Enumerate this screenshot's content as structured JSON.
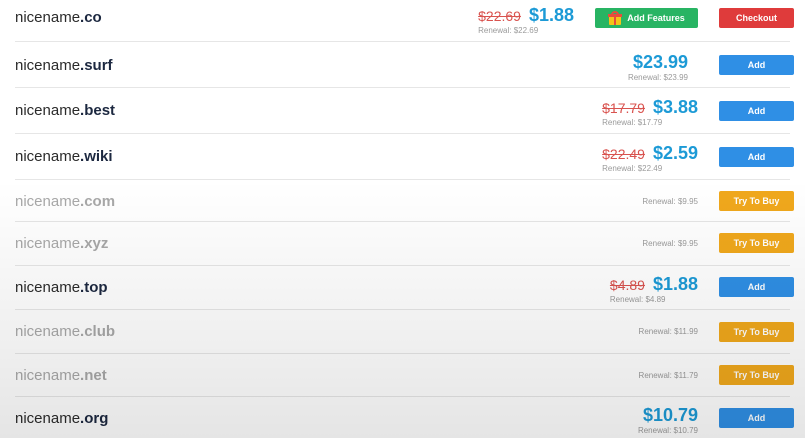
{
  "domains": [
    {
      "name": "nicename",
      "tld": ".co",
      "old_price": "$22.69",
      "price": "$1.88",
      "renewal": "Renewal: $22.69",
      "features_label": "Add Features",
      "action": "Checkout"
    },
    {
      "name": "nicename",
      "tld": ".surf",
      "price": "$23.99",
      "renewal": "Renewal: $23.99",
      "action": "Add"
    },
    {
      "name": "nicename",
      "tld": ".best",
      "old_price": "$17.79",
      "price": "$3.88",
      "renewal": "Renewal: $17.79",
      "action": "Add"
    },
    {
      "name": "nicename",
      "tld": ".wiki",
      "old_price": "$22.49",
      "price": "$2.59",
      "renewal": "Renewal: $22.49",
      "action": "Add"
    },
    {
      "name": "nicename",
      "tld": ".com",
      "renewal": "Renewal: $9.95",
      "action": "Try To Buy"
    },
    {
      "name": "nicename",
      "tld": ".xyz",
      "renewal": "Renewal: $9.95",
      "action": "Try To Buy"
    },
    {
      "name": "nicename",
      "tld": ".top",
      "old_price": "$4.89",
      "price": "$1.88",
      "renewal": "Renewal: $4.89",
      "action": "Add"
    },
    {
      "name": "nicename",
      "tld": ".club",
      "renewal": "Renewal: $11.99",
      "action": "Try To Buy"
    },
    {
      "name": "nicename",
      "tld": ".net",
      "renewal": "Renewal: $11.79",
      "action": "Try To Buy"
    },
    {
      "name": "nicename",
      "tld": ".org",
      "price": "$10.79",
      "renewal": "Renewal: $10.79",
      "action": "Add"
    }
  ],
  "colors": {
    "add": "#2f8fe5",
    "try": "#f0a81c",
    "checkout": "#df3b3b",
    "features": "#28b463",
    "price": "#1c9ad6",
    "old_price": "#d9534f"
  }
}
